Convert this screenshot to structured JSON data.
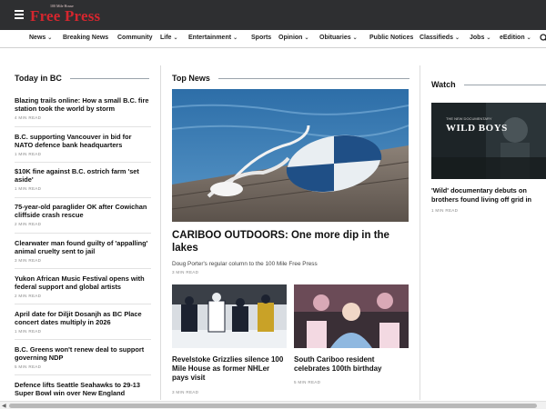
{
  "header": {
    "logo_kicker": "100 Mile House",
    "logo_name": "Free Press"
  },
  "nav": {
    "items": [
      {
        "label": "News",
        "dropdown": true
      },
      {
        "label": "Breaking News",
        "dropdown": false
      },
      {
        "label": "Community",
        "dropdown": false
      },
      {
        "label": "Life",
        "dropdown": true
      },
      {
        "label": "Entertainment",
        "dropdown": true
      },
      {
        "label": "Sports",
        "dropdown": false
      },
      {
        "label": "Opinion",
        "dropdown": true
      },
      {
        "label": "Obituaries",
        "dropdown": true
      },
      {
        "label": "Public Notices",
        "dropdown": false
      },
      {
        "label": "Classifieds",
        "dropdown": true
      },
      {
        "label": "Jobs",
        "dropdown": true
      },
      {
        "label": "eEdition",
        "dropdown": true
      }
    ],
    "chevron": "⌄"
  },
  "today": {
    "title": "Today in BC",
    "articles": [
      {
        "title": "Blazing trails online: How a small B.C. fire station took the world by storm",
        "meta": "4 MIN READ"
      },
      {
        "title": "B.C. supporting Vancouver in bid for NATO defence bank headquarters",
        "meta": "1 MIN READ"
      },
      {
        "title": "$10K fine against B.C. ostrich farm 'set aside'",
        "meta": "1 MIN READ"
      },
      {
        "title": "75-year-old paraglider OK after Cowichan cliffside crash rescue",
        "meta": "2 MIN READ"
      },
      {
        "title": "Clearwater man found guilty of 'appalling' animal cruelty sent to jail",
        "meta": "3 MIN READ"
      },
      {
        "title": "Yukon African Music Festival opens with federal support and global artists",
        "meta": "2 MIN READ"
      },
      {
        "title": "April date for Diljit Dosanjh as BC Place concert dates multiply in 2026",
        "meta": "1 MIN READ"
      },
      {
        "title": "B.C. Greens won't renew deal to support governing NDP",
        "meta": "5 MIN READ"
      },
      {
        "title": "Defence lifts Seattle Seahawks to 29-13 Super Bowl win over New England",
        "meta": ""
      }
    ]
  },
  "top_news": {
    "title": "Top News",
    "hero": {
      "title": "CARIBOO OUTDOORS: One more dip in the lakes",
      "subtitle": "Doug Porter's regular column to the 100 Mile Free Press",
      "meta": "3 MIN READ"
    },
    "cards": [
      {
        "title": "Revelstoke Grizzlies silence 100 Mile House as former NHLer pays visit",
        "meta": "3 MIN READ"
      },
      {
        "title": "South Cariboo resident celebrates 100th birthday",
        "meta": "5 MIN READ"
      }
    ]
  },
  "watch": {
    "title": "Watch",
    "thumb_title": "WILD BOYS",
    "thumb_kicker": "THE NEW DOCUMENTARY",
    "article": {
      "title": "'Wild' documentary debuts on brothers found living off grid in",
      "meta": "1 MIN READ"
    }
  },
  "scrollbar": {
    "left_arrow": "◀"
  }
}
